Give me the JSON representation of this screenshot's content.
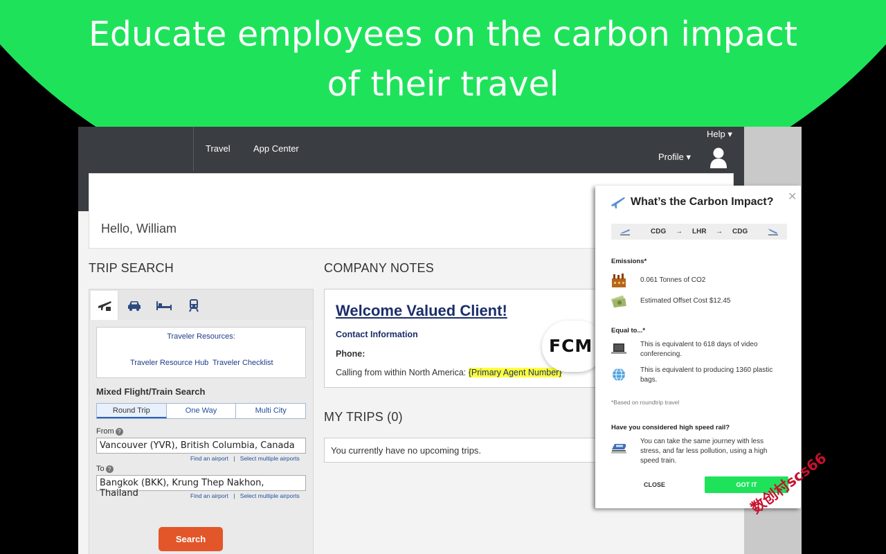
{
  "headline": {
    "line1": "Educate employees on the carbon impact",
    "line2": "of their travel"
  },
  "topbar": {
    "nav_travel": "Travel",
    "nav_app_center": "App Center",
    "help": "Help ▾",
    "profile": "Profile ▾"
  },
  "greeting": "Hello, William",
  "trip_search": {
    "title": "TRIP SEARCH",
    "resources_heading": "Traveler Resources:",
    "resource_hub": "Traveler Resource Hub",
    "resource_checklist": "Traveler Checklist",
    "mixed_title": "Mixed Flight/Train Search",
    "trip_types": [
      "Round Trip",
      "One Way",
      "Multi City"
    ],
    "from_label": "From",
    "from_value": "Vancouver (YVR), British Columbia, Canada",
    "to_label": "To",
    "to_value": "Bangkok (BKK), Krung Thep Nakhon, Thailand",
    "find_airport": "Find an airport",
    "separator": "|",
    "select_multiple": "Select multiple airports",
    "search_button": "Search"
  },
  "company_notes": {
    "title": "COMPANY NOTES",
    "welcome": "Welcome Valued Client!",
    "contact_info": "Contact Information",
    "phone_label": "Phone:",
    "calling_text": "Calling from within North America: ",
    "agent_number": "{Primary Agent Number}"
  },
  "fcm_logo": "FCM",
  "my_trips": {
    "title": "MY TRIPS (0)",
    "empty_message": "You currently have no upcoming trips."
  },
  "popup": {
    "title": "What’s the Carbon Impact?",
    "route": [
      "CDG",
      "LHR",
      "CDG"
    ],
    "route_arrow": "→",
    "emissions_heading": "Emissions*",
    "tonnes": "0.061 Tonnes of CO2",
    "offset_cost": "Estimated Offset Cost $12.45",
    "equal_heading": "Equal to...*",
    "video_equiv": "This is equivalent to 618 days of video conferencing.",
    "plastic_equiv": "This is equivalent to producing 1360 plastic bags.",
    "footnote": "*Based on roundtrip travel",
    "rail_heading": "Have you considered high speed rail?",
    "rail_text": "You can take the same journey with less stress, and far less pollution, using a high speed train.",
    "close_label": "CLOSE",
    "gotit_label": "GOT IT",
    "close_x": "✕"
  },
  "watermark": "数创村scs66",
  "colors": {
    "brand_green": "#1ee35a",
    "topbar": "#3a3d41",
    "search_orange": "#e2562a",
    "link_blue": "#1f3b8a"
  }
}
